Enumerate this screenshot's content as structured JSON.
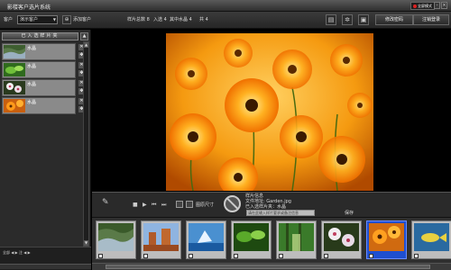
{
  "titlebar": {
    "title": "影楼客户选片系统",
    "mode_label": "全屏模式",
    "min_label": "-",
    "close_label": "×"
  },
  "toolbar": {
    "customer_label": "客户",
    "customer_value": "演示客户",
    "add_customer_label": "添加客户",
    "stats": {
      "total": "样片总数 8",
      "selected": "入选 4",
      "album": "其中水晶 4",
      "count": "共 4"
    },
    "change_password": "修改密码",
    "logout": "注销登录"
  },
  "left_panel": {
    "header": "已入选样片夹",
    "items": [
      {
        "name": "水晶"
      },
      {
        "name": "水晶"
      },
      {
        "name": "水晶"
      },
      {
        "name": "水晶"
      }
    ],
    "bottom_tabs": "全部 ◀ ▶ 注 ◀ ▶"
  },
  "controls": {
    "fit_label": "图原尺寸",
    "info_filename": "样片信息",
    "info_file": "文件地址: Garden.jpg",
    "info_album": "已入选样片夹：水晶",
    "comment": "请在此输入样片要求或备注信息",
    "save_label": "保存"
  },
  "filmstrip": {
    "thumbs": [
      {
        "name": "river-thumb",
        "selected": false
      },
      {
        "name": "canyon-thumb",
        "selected": false
      },
      {
        "name": "iceberg-thumb",
        "selected": false
      },
      {
        "name": "green-leaves-thumb",
        "selected": false
      },
      {
        "name": "forest-thumb",
        "selected": false
      },
      {
        "name": "pink-flowers-thumb",
        "selected": false
      },
      {
        "name": "orange-flowers-thumb",
        "selected": true
      },
      {
        "name": "fish-thumb",
        "selected": false
      }
    ]
  },
  "colors": {
    "selected_frame": "#1f4fd0",
    "flower_orange": "#ff8a00"
  }
}
